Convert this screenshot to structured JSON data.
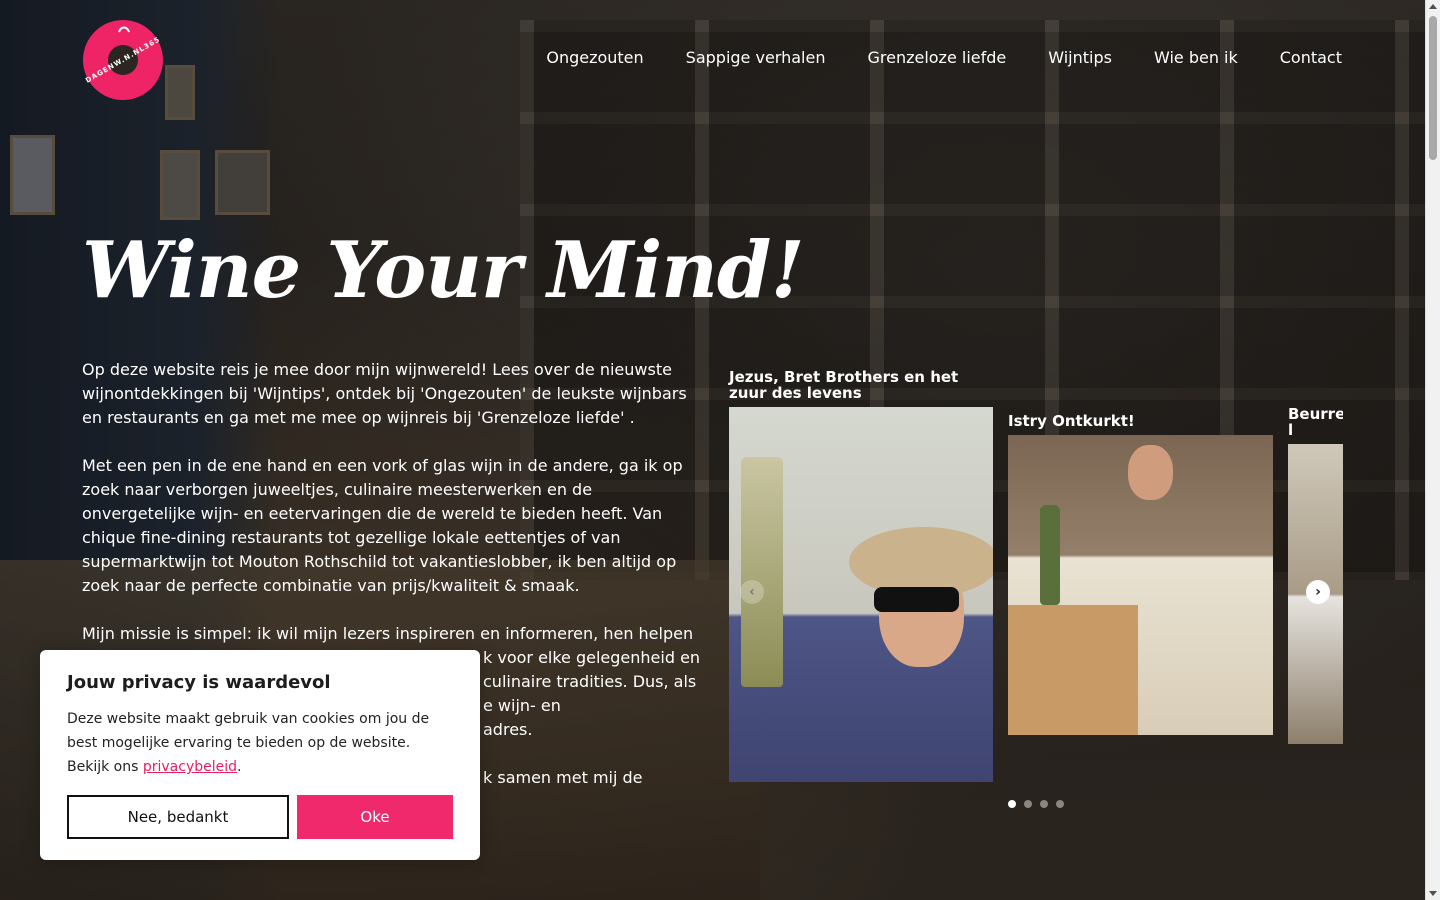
{
  "brand": {
    "logo_text": "DAGENW.N.NL365",
    "accent_color": "#ee2467"
  },
  "nav": {
    "items": [
      {
        "label": "Ongezouten"
      },
      {
        "label": "Sappige verhalen"
      },
      {
        "label": "Grenzeloze liefde"
      },
      {
        "label": "Wijntips"
      },
      {
        "label": "Wie ben ik"
      },
      {
        "label": "Contact"
      }
    ]
  },
  "hero": {
    "title": "Wine Your Mind!",
    "paragraphs": [
      "Op deze website reis je mee door mijn wijnwereld! Lees over de nieuwste wijnontdekkingen bij 'Wijntips', ontdek bij 'Ongezouten' de leukste wijnbars en restaurants en ga met me mee op wijnreis bij 'Grenzeloze liefde' .",
      "Met een pen in de ene hand en een vork of glas wijn in de andere, ga ik op zoek naar verborgen juweeltjes, culinaire meesterwerken en de onvergetelijke wijn- en eetervaringen die de wereld te bieden heeft. Van chique fine-dining restaurants tot gezellige lokale eettentjes of van supermarktwijn tot Mouton Rothschild tot vakantieslobber, ik ben altijd op zoek naar de perfecte combinatie van prijs/kwaliteit & smaak.",
      "Mijn missie is simpel: ik wil mijn lezers inspireren en informeren, hen helpen bij",
      "k voor elke gelegenheid en",
      "culinaire tradities. Dus, als",
      "e wijn- en",
      "adres.",
      "k samen met mij de"
    ]
  },
  "carousel": {
    "cards": [
      {
        "title": "Jezus, Bret Brothers en het zuur des levens"
      },
      {
        "title": "Istry Ontkurkt!"
      },
      {
        "title": "Beurre meter l"
      }
    ],
    "prev_icon": "chevron-left-icon",
    "next_icon": "chevron-right-icon",
    "dots": 4,
    "active_dot": 0
  },
  "cookie": {
    "title": "Jouw privacy is waardevol",
    "text_before_link": "Deze website maakt gebruik van cookies om jou de best mogelijke ervaring te bieden op de website. Bekijk ons ",
    "link_label": "privacybeleid",
    "text_after_link": ".",
    "decline_label": "Nee, bedankt",
    "accept_label": "Oke",
    "accept_color": "#f0296c"
  }
}
